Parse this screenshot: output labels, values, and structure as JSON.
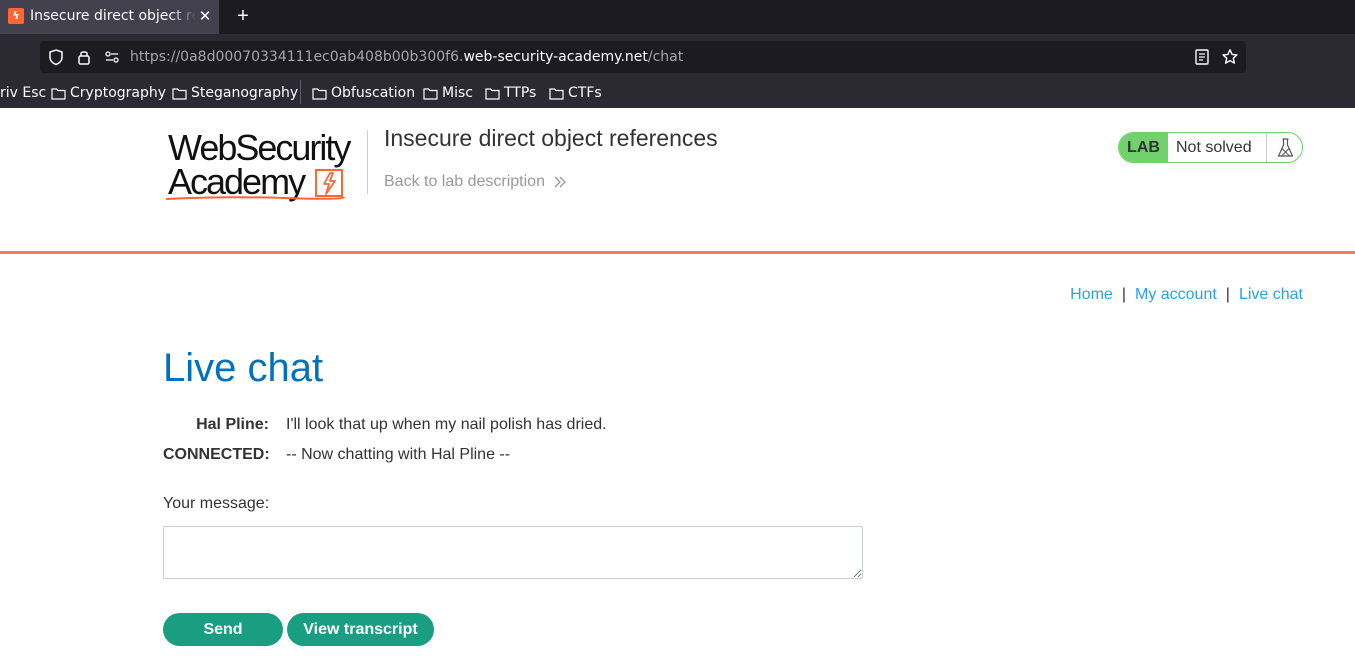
{
  "browser": {
    "tab_title": "Insecure direct object references",
    "tab_close_icon": "close-icon",
    "new_tab_label": "+",
    "url_prefix": "https://0a8d00070334111ec0ab408b00b300f6.",
    "url_host": "web-security-academy.net",
    "url_path": "/chat",
    "bookmarks": [
      {
        "label": "riv Esc"
      },
      {
        "label": "Cryptography"
      },
      {
        "label": "Steganography"
      },
      {
        "label": "Obfuscation"
      },
      {
        "label": "Misc"
      },
      {
        "label": "TTPs"
      },
      {
        "label": "CTFs"
      }
    ]
  },
  "header": {
    "logo_line1": "WebSecurity",
    "logo_line2": "Academy",
    "lab_title": "Insecure direct object references",
    "back_link": "Back to lab description",
    "lab_tag": "LAB",
    "lab_status": "Not solved",
    "colors": {
      "accent": "#ff6633",
      "lab_green": "#70d16d",
      "title_blue": "#0071bc",
      "link_blue": "#29a3e6",
      "button_green": "#1a9e82"
    }
  },
  "topnav": {
    "home": "Home",
    "separator": "|",
    "my_account": "My account",
    "live_chat": "Live chat"
  },
  "chat": {
    "heading": "Live chat",
    "messages": [
      {
        "author": "Hal Pline:",
        "text": "I'll look that up when my nail polish has dried."
      },
      {
        "author": "CONNECTED:",
        "text": "-- Now chatting with Hal Pline --"
      }
    ],
    "message_label": "Your message:",
    "message_value": "",
    "send_label": "Send",
    "transcript_label": "View transcript"
  }
}
